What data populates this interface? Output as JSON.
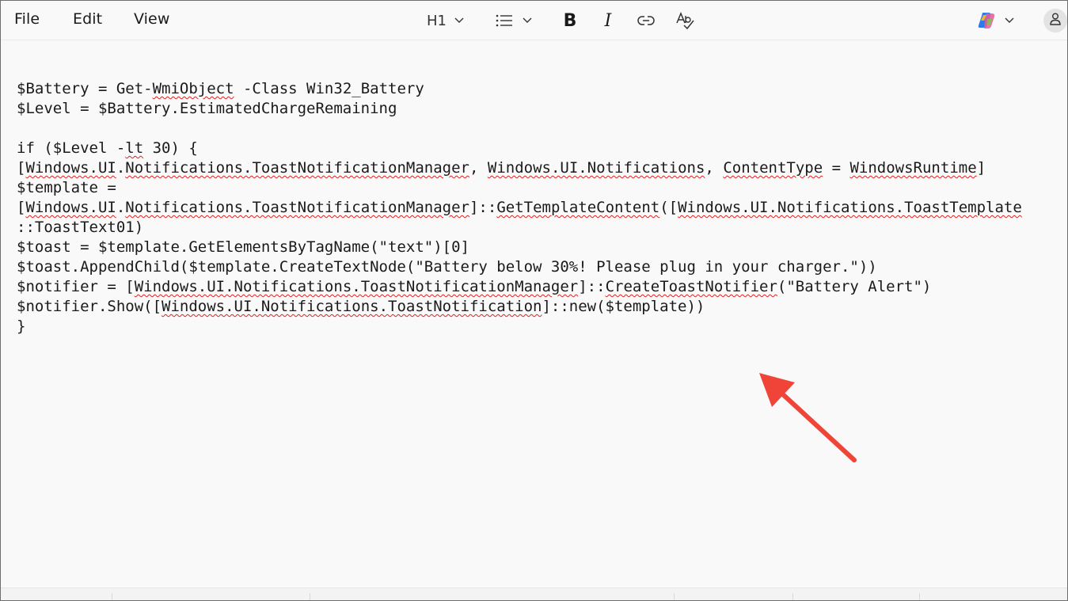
{
  "menu": {
    "file": "File",
    "edit": "Edit",
    "view": "View"
  },
  "toolbar": {
    "heading": "H1",
    "icons": [
      "chevron-down-icon",
      "list-icon",
      "bold-icon",
      "italic-icon",
      "link-icon",
      "spellcheck-icon",
      "copilot-icon",
      "profile-icon"
    ],
    "bold_glyph": "B",
    "italic_glyph": "I"
  },
  "editor": {
    "lines": [
      [
        {
          "t": "$Battery = Get-"
        },
        {
          "t": "WmiObject",
          "sq": true
        },
        {
          "t": " -Class Win32_Battery"
        }
      ],
      [
        {
          "t": "$Level = $Battery.EstimatedChargeRemaining"
        }
      ],
      [
        {
          "t": ""
        }
      ],
      [
        {
          "t": "if ($Level -"
        },
        {
          "t": "lt",
          "sq": true
        },
        {
          "t": " 30) {"
        }
      ],
      [
        {
          "t": "["
        },
        {
          "t": "Windows.UI",
          "sq": true
        },
        {
          "t": "."
        },
        {
          "t": "Notifications.ToastNotificationManager",
          "sq": true
        },
        {
          "t": ", "
        },
        {
          "t": "Windows.UI.Notifications",
          "sq": true
        },
        {
          "t": ", "
        },
        {
          "t": "ContentType",
          "sq": true
        },
        {
          "t": " = "
        },
        {
          "t": "WindowsRuntime",
          "sq": true
        },
        {
          "t": "]"
        }
      ],
      [
        {
          "t": "$template ="
        }
      ],
      [
        {
          "t": "["
        },
        {
          "t": "Windows.UI",
          "sq": true
        },
        {
          "t": "."
        },
        {
          "t": "Notifications.ToastNotificationManager",
          "sq": true
        },
        {
          "t": "]::"
        },
        {
          "t": "GetTemplateContent",
          "sq": true
        },
        {
          "t": "(["
        },
        {
          "t": "Windows.UI.Notifications.ToastTemplate",
          "sq": true
        }
      ],
      [
        {
          "t": "::ToastText01)"
        }
      ],
      [
        {
          "t": "$toast = $template.GetElementsByTagName(\"text\")[0]"
        }
      ],
      [
        {
          "t": "$toast.AppendChild($template.CreateTextNode(\"Battery below 30%! Please plug in your charger.\"))"
        }
      ],
      [
        {
          "t": "$notifier = ["
        },
        {
          "t": "Windows.UI.Notifications.ToastNotificationManager",
          "sq": true
        },
        {
          "t": "]::"
        },
        {
          "t": "CreateToastNotifier",
          "sq": true
        },
        {
          "t": "(\"Battery Alert\")"
        }
      ],
      [
        {
          "t": "$notifier.Show(["
        },
        {
          "t": "Windows.UI.Notifications.ToastNotification",
          "sq": true
        },
        {
          "t": "]::new($template))"
        }
      ],
      [
        {
          "t": "}"
        }
      ]
    ]
  },
  "colors": {
    "annotation_arrow": "#f04438",
    "spellcheck_squiggle": "#e02020",
    "background": "#f9f9f9"
  }
}
